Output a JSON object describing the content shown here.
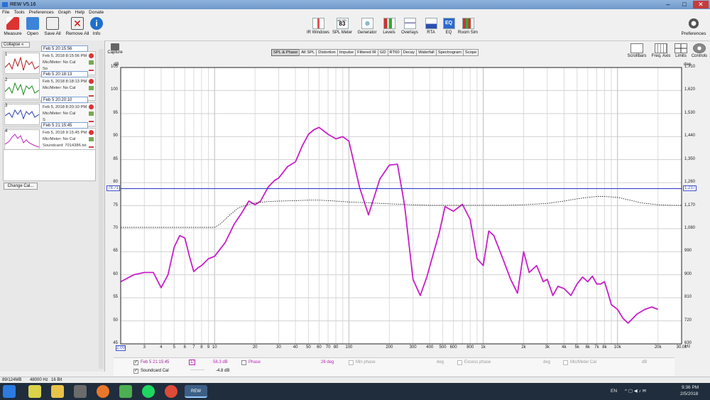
{
  "window": {
    "title": "REW V5.16"
  },
  "menu": [
    "File",
    "Tools",
    "Preferences",
    "Graph",
    "Help",
    "Donate"
  ],
  "toolbar_left": [
    {
      "label": "Measure",
      "icon": "measure-icon"
    },
    {
      "label": "Open",
      "icon": "open-icon"
    },
    {
      "label": "Save All",
      "icon": "save-icon"
    },
    {
      "label": "Remove All",
      "icon": "remove-icon"
    },
    {
      "label": "Info",
      "icon": "info-icon"
    }
  ],
  "toolbar_center": [
    {
      "label": "IR Windows",
      "icon": "ir-windows-icon"
    },
    {
      "label": "SPL Meter",
      "icon": "spl-meter-icon",
      "badge_top": "dB SPL",
      "badge_value": "83"
    },
    {
      "label": "Generator",
      "icon": "generator-icon"
    },
    {
      "label": "Levels",
      "icon": "levels-icon"
    },
    {
      "label": "Overlays",
      "icon": "overlays-icon"
    },
    {
      "label": "RTA",
      "icon": "rta-icon"
    },
    {
      "label": "EQ",
      "icon": "eq-icon"
    },
    {
      "label": "Room Sim",
      "icon": "room-sim-icon"
    }
  ],
  "toolbar_right": {
    "label": "Preferences",
    "icon": "preferences-icon"
  },
  "left_panel": {
    "collapse_label": "Collapse",
    "change_cal_label": "Change Cal...",
    "measurements": [
      {
        "num": "1",
        "name": "Feb 5 20:15:56",
        "line1": "Feb 5, 2018 8:15:56 PM",
        "line2": "Mic/Meter: No Cal",
        "line3": "So",
        "color": "#b01818"
      },
      {
        "num": "2",
        "name": "Feb 5 20:18:13",
        "line1": "Feb 5, 2018 8:18:13 PM",
        "line2": "Mic/Meter: No Cal",
        "line3": "",
        "color": "#1a8a1a"
      },
      {
        "num": "3",
        "name": "Feb 5 20:20:10",
        "line1": "Feb 5, 2018 8:20:10 PM",
        "line2": "Mic/Meter: No Cal",
        "line3": "S",
        "color": "#2a3fb0"
      },
      {
        "num": "4",
        "name": "Feb 5 21:15:45",
        "line1": "Feb 5, 2018 9:15:45 PM",
        "line2": "Mic/Meter: No Cal",
        "line3": "Soundcard: 7014386.txt",
        "color": "#c020c0"
      }
    ]
  },
  "graph": {
    "capture_label": "Capture",
    "tabs": [
      "SPL & Phase",
      "All SPL",
      "Distortion",
      "Impulse",
      "Filtered IR",
      "GD",
      "RT60",
      "Decay",
      "Waterfall",
      "Spectrogram",
      "Scope"
    ],
    "active_tab": "SPL & Phase",
    "right_tools": [
      "Scrollbars",
      "Freq. Axis",
      "Limits",
      "Controls"
    ],
    "left_unit": "dB",
    "right_unit": "deg",
    "x_unit": "Hz",
    "y_ticks": [
      "45",
      "50",
      "55",
      "60",
      "65",
      "70",
      "75",
      "80",
      "85",
      "90",
      "95",
      "100",
      "105"
    ],
    "y_right_ticks": [
      "630",
      "720",
      "810",
      "900",
      "990",
      "1,080",
      "1,170",
      "1,260",
      "1,350",
      "1,440",
      "1,530",
      "1,620",
      "1,710"
    ],
    "x_ticks": [
      "2.00",
      "3",
      "4",
      "5",
      "6",
      "7",
      "8",
      "9",
      "10",
      "20",
      "30",
      "40",
      "50",
      "60",
      "70",
      "80",
      "100",
      "200",
      "300",
      "400",
      "500",
      "600",
      "800",
      "1k",
      "2k",
      "3k",
      "4k",
      "5k",
      "6k",
      "7k",
      "8k",
      "10k",
      "20k",
      "30.0k"
    ],
    "cursor_left": "78.71",
    "cursor_right": "1,237"
  },
  "chart_data": {
    "type": "line",
    "xlabel": "Hz",
    "ylabel": "dB",
    "xscale": "log",
    "xlim": [
      2,
      30000
    ],
    "ylim": [
      45,
      105
    ],
    "y2lim": [
      630,
      1710
    ],
    "grid": true,
    "series": [
      {
        "name": "Feb 5 21:15:45",
        "color": "#c81ec8",
        "x": [
          2,
          2.5,
          3,
          3.5,
          4,
          4.5,
          5,
          5.5,
          6,
          6.5,
          7,
          7.5,
          8,
          9,
          10,
          12,
          14,
          16,
          18,
          20,
          22,
          25,
          28,
          30,
          35,
          40,
          45,
          50,
          55,
          60,
          70,
          80,
          90,
          100,
          120,
          140,
          170,
          200,
          230,
          260,
          300,
          340,
          380,
          420,
          470,
          520,
          600,
          700,
          800,
          900,
          1000,
          1100,
          1200,
          1400,
          1600,
          1800,
          2000,
          2200,
          2500,
          2800,
          3000,
          3300,
          3600,
          4000,
          4500,
          5000,
          5500,
          6000,
          6500,
          7000,
          7500,
          8000,
          8500,
          9000,
          10000,
          11000,
          12000,
          14000,
          16000,
          18000,
          20000
        ],
        "y": [
          58.5,
          60,
          60.5,
          60.5,
          57.2,
          60,
          66,
          68.5,
          68,
          64,
          60.7,
          61.5,
          62,
          63.5,
          64,
          67,
          71,
          73.5,
          76,
          75.2,
          76,
          79,
          80.5,
          81,
          83.5,
          84.5,
          88,
          90.5,
          91.5,
          92,
          90.5,
          89.5,
          90,
          89,
          79,
          73,
          80.8,
          83.8,
          84,
          75,
          59,
          55.5,
          59.5,
          64,
          69,
          74.8,
          73.8,
          75.3,
          72,
          63.5,
          62,
          69.5,
          68.5,
          63.5,
          59,
          56,
          65,
          60.5,
          62,
          58.5,
          59,
          55.5,
          57.5,
          57,
          55.5,
          58,
          59.5,
          58.5,
          59.7,
          58,
          58,
          58.5,
          56,
          53.5,
          52.5,
          50.5,
          49.5,
          51.5,
          52.5,
          53,
          52.5
        ]
      },
      {
        "name": "Soundcard Cal",
        "color": "#222222",
        "x": [
          2,
          5,
          10,
          11,
          13,
          15,
          18,
          20,
          25,
          30,
          40,
          50,
          60,
          70,
          80,
          100,
          150,
          200,
          300,
          400,
          500,
          700,
          1000,
          1500,
          2000,
          3000,
          4000,
          5000,
          6000,
          7000,
          8000,
          10000,
          12000,
          15000,
          20000,
          25000,
          30000
        ],
        "y": [
          70.3,
          70.3,
          70.3,
          71,
          73,
          74.5,
          75.3,
          75.6,
          75.9,
          76,
          76.1,
          76.2,
          76.2,
          76.1,
          76,
          75.8,
          75.6,
          75.4,
          75.2,
          75.1,
          75.1,
          75.1,
          75.1,
          75.1,
          75.2,
          75.5,
          76,
          76.5,
          76.8,
          77,
          77,
          76.8,
          76.3,
          75.6,
          75.2,
          75.1,
          75.1
        ]
      }
    ]
  },
  "legend": {
    "row1": {
      "name": "Feb 5 21:15:45",
      "marker": "1/",
      "value": "58.3 dB",
      "phase_label": "Phase",
      "phase_value": "26 deg",
      "min_phase": "Min phase",
      "min_phase_unit": "deg",
      "excess_phase": "Excess phase",
      "excess_unit": "deg",
      "mic_cal": "Mic/Meter Cal",
      "mic_cal_unit": "dB"
    },
    "row2": {
      "name": "Soundcard Cal",
      "value": "-4.8 dB"
    }
  },
  "status": {
    "memory": "89/124MB",
    "rate": "48000 Hz",
    "bits": "16 Bit"
  },
  "taskbar": {
    "apps": [
      "chrome-like-icon",
      "folder-icon",
      "firefox-icon",
      "torrent-icon",
      "spotify-icon",
      "chrome-icon"
    ],
    "active_app": "REW",
    "lang": "EN",
    "time": "9:36 PM",
    "date": "2/5/2018"
  }
}
